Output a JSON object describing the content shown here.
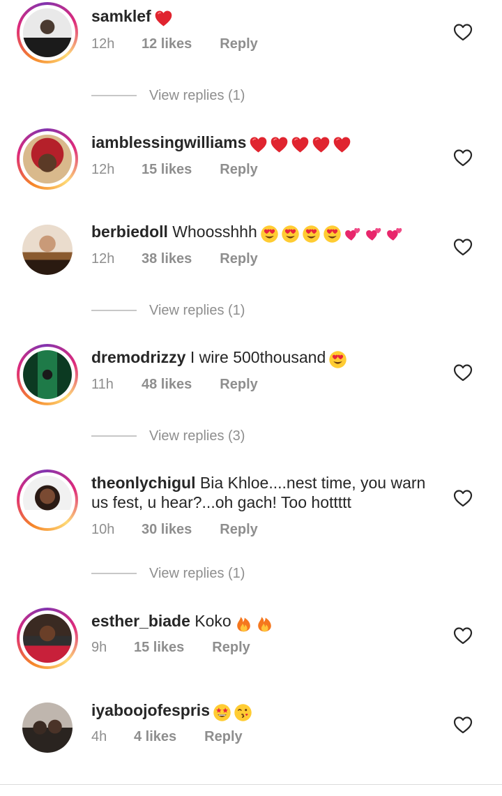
{
  "comments": [
    {
      "username": "samklef",
      "text": "",
      "emojis": [
        "red-heart"
      ],
      "time": "12h",
      "likes": "12 likes",
      "reply": "Reply",
      "view_replies": "View replies (1)",
      "has_story": true
    },
    {
      "username": "iamblessingwilliams",
      "text": "",
      "emojis": [
        "red-heart",
        "red-heart",
        "red-heart",
        "red-heart",
        "red-heart"
      ],
      "time": "12h",
      "likes": "15 likes",
      "reply": "Reply",
      "view_replies": "",
      "has_story": true
    },
    {
      "username": "berbiedoll",
      "text": "Whoosshhh",
      "emojis": [
        "heart-eyes",
        "heart-eyes",
        "heart-eyes",
        "heart-eyes",
        "two-hearts",
        "two-hearts",
        "two-hearts"
      ],
      "time": "12h",
      "likes": "38 likes",
      "reply": "Reply",
      "view_replies": "View replies (1)",
      "has_story": false
    },
    {
      "username": "dremodrizzy",
      "text": "I wire 500thousand",
      "emojis": [
        "heart-eyes"
      ],
      "time": "11h",
      "likes": "48 likes",
      "reply": "Reply",
      "view_replies": "View replies (3)",
      "has_story": true
    },
    {
      "username": "theonlychigul",
      "text_line1": "Bia Khloe....nest time, you warn",
      "text_line2": "us fest, u hear?...oh gach! Too hottttt",
      "emojis": [],
      "time": "10h",
      "likes": "30 likes",
      "reply": "Reply",
      "view_replies": "View replies (1)",
      "has_story": true
    },
    {
      "username": "esther_biade",
      "text": "Koko",
      "emojis": [
        "fire",
        "fire"
      ],
      "time": "9h",
      "likes": "15 likes",
      "reply": "Reply",
      "view_replies": "",
      "has_story": true
    },
    {
      "username": "iyaboojofespris",
      "text": "",
      "emojis": [
        "star-struck",
        "face-blowing-kiss"
      ],
      "time": "4h",
      "likes": "4 likes",
      "reply": "Reply",
      "view_replies": "",
      "has_story": false
    }
  ],
  "colors": {
    "text": "#262626",
    "muted": "#8e8e8e",
    "heart_red": "#e0242f",
    "emoji_yellow": "#ffcc33",
    "fire_orange": "#f5771e"
  }
}
